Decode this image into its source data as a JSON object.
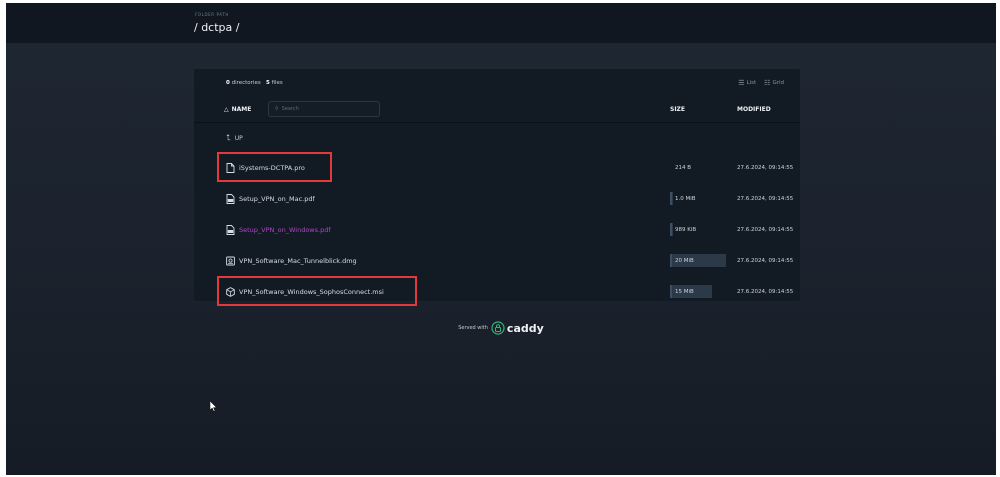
{
  "header": {
    "folder_label": "FOLDER PATH",
    "path": "/ dctpa /"
  },
  "listing": {
    "summary": {
      "dir_count": "0",
      "dir_label": "directories",
      "file_count": "5",
      "file_label": "files"
    },
    "view_toggles": {
      "list_icon": "list-icon",
      "list_label": "List",
      "grid_icon": "grid-icon",
      "grid_label": "Grid"
    },
    "columns": {
      "name": "NAME",
      "size": "SIZE",
      "modified": "MODIFIED"
    },
    "search_placeholder": "Search",
    "up_label": "UP",
    "files": [
      {
        "name": "iSystems-DCTPA.pro",
        "icon": "file-icon",
        "size": "214 B",
        "size_fraction": 0.0,
        "modified": "27.6.2024, 09:14:55",
        "visited": false,
        "highlighted": true
      },
      {
        "name": "Setup_VPN_on_Mac.pdf",
        "icon": "pdf-file-icon",
        "size": "1.0 MiB",
        "size_fraction": 0.05,
        "modified": "27.6.2024, 09:14:55",
        "visited": false,
        "highlighted": false
      },
      {
        "name": "Setup_VPN_on_Windows.pdf",
        "icon": "pdf-file-icon",
        "size": "989 KiB",
        "size_fraction": 0.05,
        "modified": "27.6.2024, 09:14:55",
        "visited": true,
        "highlighted": false
      },
      {
        "name": "VPN_Software_Mac_Tunnelblick.dmg",
        "icon": "disk-image-icon",
        "size": "20 MiB",
        "size_fraction": 1.0,
        "modified": "27.6.2024, 09:14:55",
        "visited": false,
        "highlighted": false
      },
      {
        "name": "VPN_Software_Windows_SophosConnect.msi",
        "icon": "package-icon",
        "size": "15 MiB",
        "size_fraction": 0.75,
        "modified": "27.6.2024, 09:14:55",
        "visited": false,
        "highlighted": true
      }
    ]
  },
  "footer": {
    "served_with": "Served with",
    "brand": "caddy"
  },
  "colors": {
    "background": "#1b222d",
    "header": "#101720",
    "panel": "#121a24",
    "visited_link": "#b445c8",
    "highlight_box": "#e23a3a",
    "size_bar": "#2b3949"
  }
}
